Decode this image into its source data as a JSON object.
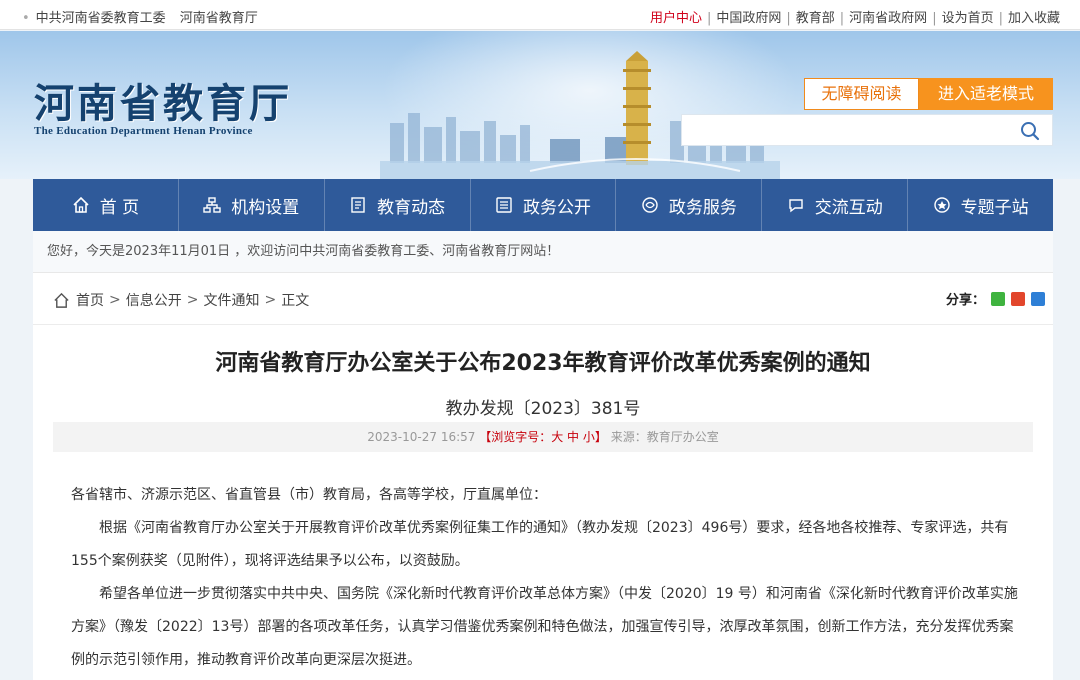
{
  "topbar": {
    "left_links": [
      "中共河南省委教育工委",
      "河南省教育厅"
    ],
    "right_links": [
      "用户中心",
      "中国政府网",
      "教育部",
      "河南省政府网",
      "设为首页",
      "加入收藏"
    ]
  },
  "header": {
    "logo_cn": "河南省教育厅",
    "logo_en": "The Education Department Henan Province",
    "access_button": "无障碍阅读",
    "elder_button": "进入适老模式",
    "search_placeholder": ""
  },
  "nav": {
    "items": [
      {
        "label": "首 页",
        "icon": "home-icon"
      },
      {
        "label": "机构设置",
        "icon": "org-chart-icon"
      },
      {
        "label": "教育动态",
        "icon": "news-icon"
      },
      {
        "label": "政务公开",
        "icon": "document-icon"
      },
      {
        "label": "政务服务",
        "icon": "service-icon"
      },
      {
        "label": "交流互动",
        "icon": "chat-icon"
      },
      {
        "label": "专题子站",
        "icon": "topic-icon"
      }
    ]
  },
  "welcome": "您好，今天是2023年11月01日 ，欢迎访问中共河南省委教育工委、河南省教育厅网站！",
  "breadcrumb": [
    "首页",
    "信息公开",
    "文件通知",
    "正文"
  ],
  "share_label": "分享：",
  "article": {
    "title": "河南省教育厅办公室关于公布2023年教育评价改革优秀案例的通知",
    "doc_no": "教办发规〔2023〕381号",
    "date": "2023-10-27 16:57",
    "font_size_label": "【浏览字号：大 中 小】",
    "source": "来源：教育厅办公室",
    "paragraphs": [
      "各省辖市、济源示范区、省直管县（市）教育局，各高等学校，厅直属单位：",
      "根据《河南省教育厅办公室关于开展教育评价改革优秀案例征集工作的通知》（教办发规〔2023〕496号）要求，经各地各校推荐、专家评选，共有155个案例获奖（见附件），现将评选结果予以公布，以资鼓励。",
      "希望各单位进一步贯彻落实中共中央、国务院《深化新时代教育评价改革总体方案》（中发〔2020〕19 号）和河南省《深化新时代教育评价改革实施方案》（豫发〔2022〕13号）部署的各项改革任务，认真学习借鉴优秀案例和特色做法，加强宣传引导，浓厚改革氛围，创新工作方法，充分发挥优秀案例的示范引领作用，推动教育评价改革向更深层次挺进。"
    ]
  },
  "colors": {
    "nav_bg": "#2f5a9a",
    "accent_orange": "#f7931e",
    "link_red": "#d0021b",
    "logo_blue": "#15426f"
  }
}
